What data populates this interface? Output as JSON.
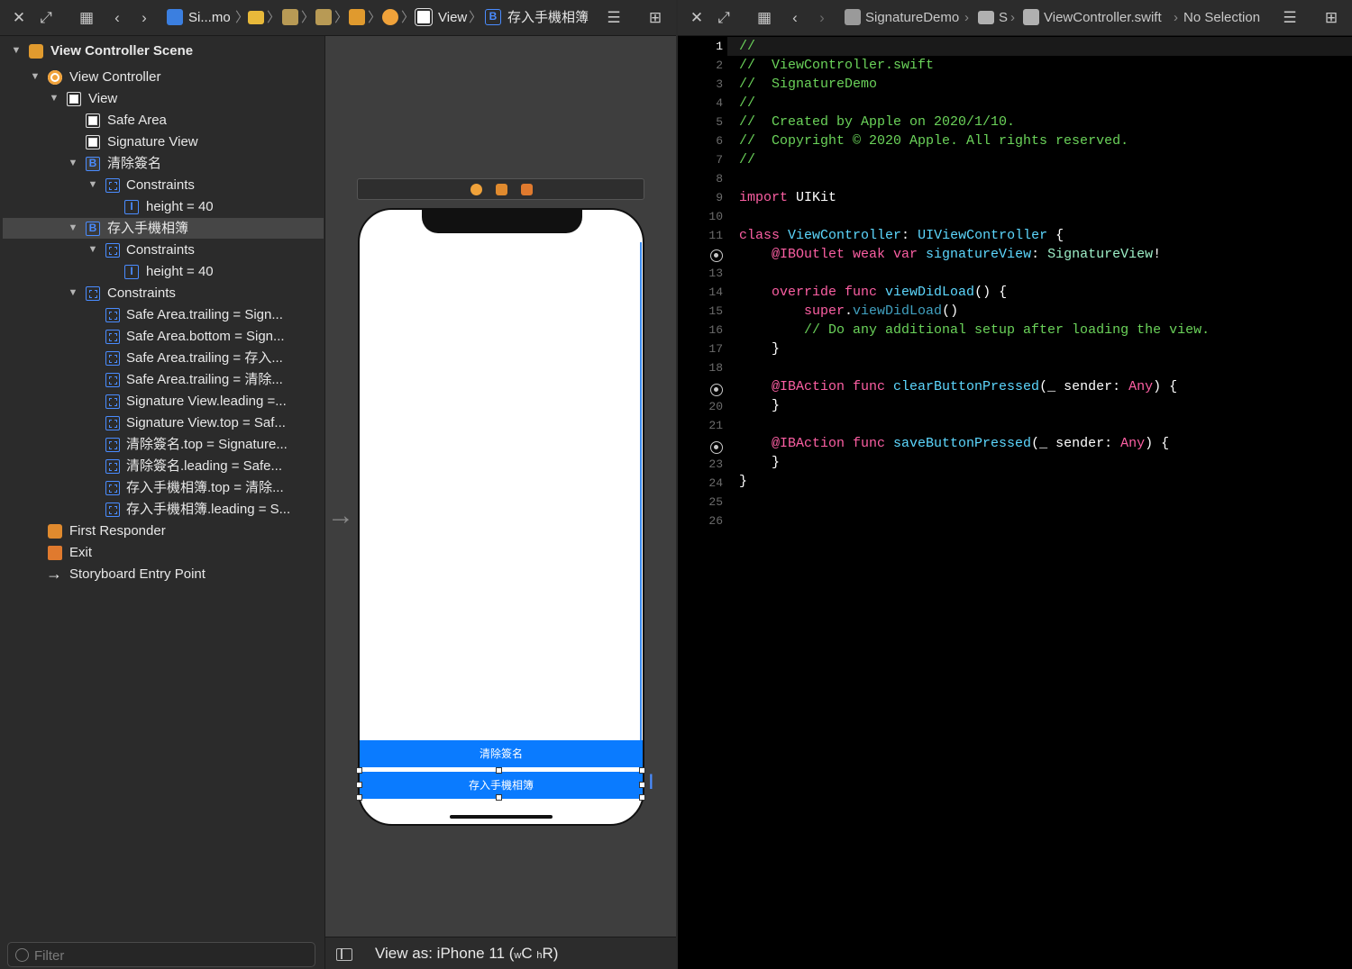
{
  "left_jumpbar": {
    "crumbs": [
      "Si...mo",
      "View",
      "存入手機相簿"
    ]
  },
  "outline": {
    "items": [
      {
        "label": "View Controller Scene",
        "icon": "scene-icon",
        "expanded": true
      },
      {
        "label": "View Controller",
        "icon": "view-controller-icon",
        "expanded": true
      },
      {
        "label": "View",
        "icon": "view-icon",
        "expanded": true
      },
      {
        "label": "Safe Area",
        "icon": "safe-area-icon"
      },
      {
        "label": "Signature View",
        "icon": "view-icon"
      },
      {
        "label": "清除簽名",
        "icon": "button-icon",
        "expanded": true
      },
      {
        "label": "Constraints",
        "icon": "constraints-icon",
        "expanded": true
      },
      {
        "label": "height = 40",
        "icon": "height-constraint-icon"
      },
      {
        "label": "存入手機相簿",
        "icon": "button-icon",
        "expanded": true,
        "selected": true
      },
      {
        "label": "Constraints",
        "icon": "constraints-icon",
        "expanded": true
      },
      {
        "label": "height = 40",
        "icon": "height-constraint-icon"
      },
      {
        "label": "Constraints",
        "icon": "constraints-icon",
        "expanded": true
      },
      {
        "label": "Safe Area.trailing = Sign...",
        "icon": "trailing-constraint-icon"
      },
      {
        "label": "Safe Area.bottom = Sign...",
        "icon": "bottom-constraint-icon"
      },
      {
        "label": "Safe Area.trailing = 存入...",
        "icon": "trailing-constraint-icon"
      },
      {
        "label": "Safe Area.trailing = 清除...",
        "icon": "trailing-constraint-icon"
      },
      {
        "label": "Signature View.leading =...",
        "icon": "leading-constraint-icon"
      },
      {
        "label": "Signature View.top = Saf...",
        "icon": "top-constraint-icon"
      },
      {
        "label": "清除簽名.top = Signature...",
        "icon": "top-constraint-icon"
      },
      {
        "label": "清除簽名.leading = Safe...",
        "icon": "leading-constraint-icon"
      },
      {
        "label": "存入手機相簿.top = 清除...",
        "icon": "top-constraint-icon"
      },
      {
        "label": "存入手機相簿.leading = S...",
        "icon": "leading-constraint-icon"
      },
      {
        "label": "First Responder",
        "icon": "first-responder-icon"
      },
      {
        "label": "Exit",
        "icon": "exit-icon"
      },
      {
        "label": "Storyboard Entry Point",
        "icon": "entry-arrow-icon"
      }
    ]
  },
  "filter": {
    "placeholder": "Filter",
    "value": ""
  },
  "canvas": {
    "buttons": {
      "clear": "清除簽名",
      "save": "存入手機相簿"
    },
    "view_as": "View as: iPhone 11 (",
    "view_as_w": "w",
    "view_as_c": "C ",
    "view_as_h": "h",
    "view_as_r": "R)"
  },
  "right_jumpbar": {
    "crumbs": [
      "SignatureDemo",
      "S",
      "ViewController.swift",
      "No Selection"
    ]
  },
  "editor": {
    "current_line": 1,
    "line_numbers": [
      "1",
      "2",
      "3",
      "4",
      "5",
      "6",
      "7",
      "8",
      "9",
      "10",
      "11",
      "",
      "13",
      "14",
      "15",
      "16",
      "17",
      "18",
      "",
      "20",
      "21",
      "",
      "23",
      "24",
      "25",
      "26"
    ],
    "connection_lines": [
      12,
      19,
      22
    ],
    "colors": {
      "comment": "#6bd35a",
      "keyword": "#fc5fa3",
      "type": "#5dd8ff",
      "background": "#000000"
    }
  },
  "colors": {
    "accent": "#0a7bff",
    "selection": "#464646"
  }
}
